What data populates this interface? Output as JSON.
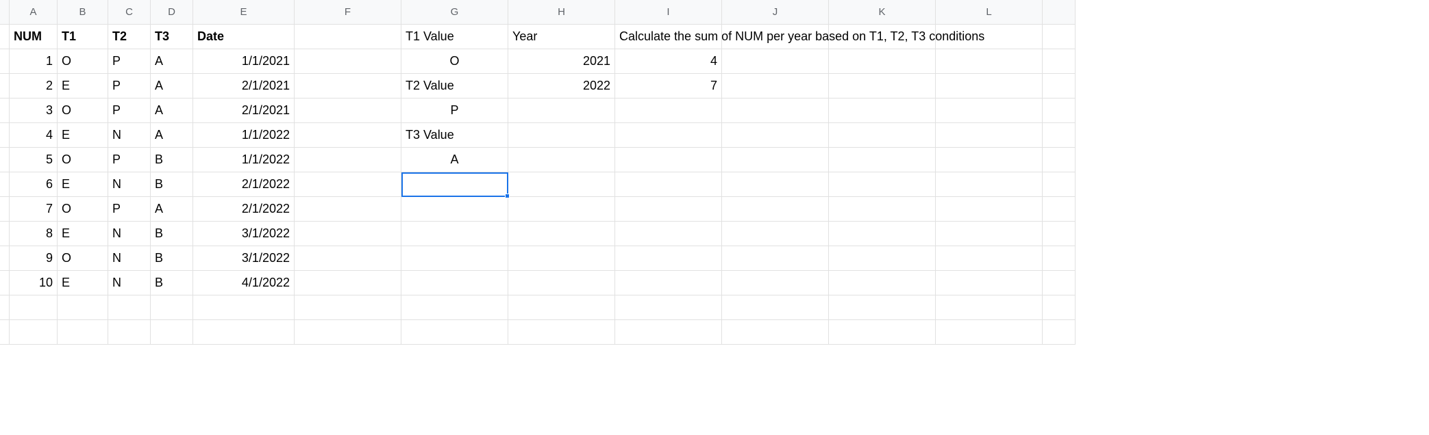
{
  "columns": [
    "A",
    "B",
    "C",
    "D",
    "E",
    "F",
    "G",
    "H",
    "I",
    "J",
    "K",
    "L"
  ],
  "headers": {
    "A": "NUM",
    "B": "T1",
    "C": "T2",
    "D": "T3",
    "E": "Date"
  },
  "data_rows": [
    {
      "num": "1",
      "t1": "O",
      "t2": "P",
      "t3": "A",
      "date": "1/1/2021"
    },
    {
      "num": "2",
      "t1": "E",
      "t2": "P",
      "t3": "A",
      "date": "2/1/2021"
    },
    {
      "num": "3",
      "t1": "O",
      "t2": "P",
      "t3": "A",
      "date": "2/1/2021"
    },
    {
      "num": "4",
      "t1": "E",
      "t2": "N",
      "t3": "A",
      "date": "1/1/2022"
    },
    {
      "num": "5",
      "t1": "O",
      "t2": "P",
      "t3": "B",
      "date": "1/1/2022"
    },
    {
      "num": "6",
      "t1": "E",
      "t2": "N",
      "t3": "B",
      "date": "2/1/2022"
    },
    {
      "num": "7",
      "t1": "O",
      "t2": "P",
      "t3": "A",
      "date": "2/1/2022"
    },
    {
      "num": "8",
      "t1": "E",
      "t2": "N",
      "t3": "B",
      "date": "3/1/2022"
    },
    {
      "num": "9",
      "t1": "O",
      "t2": "N",
      "t3": "B",
      "date": "3/1/2022"
    },
    {
      "num": "10",
      "t1": "E",
      "t2": "N",
      "t3": "B",
      "date": "4/1/2022"
    }
  ],
  "side": {
    "g1": "T1 Value",
    "g2": "O",
    "g3": "T2 Value",
    "g4": "P",
    "g5": "T3 Value",
    "g6": "A",
    "h1": "Year",
    "h2": "2021",
    "h3": "2022",
    "i1": "Calculate the sum of NUM per year based on T1, T2, T3 conditions",
    "i2": "4",
    "i3": "7"
  },
  "selected_cell": "G7"
}
